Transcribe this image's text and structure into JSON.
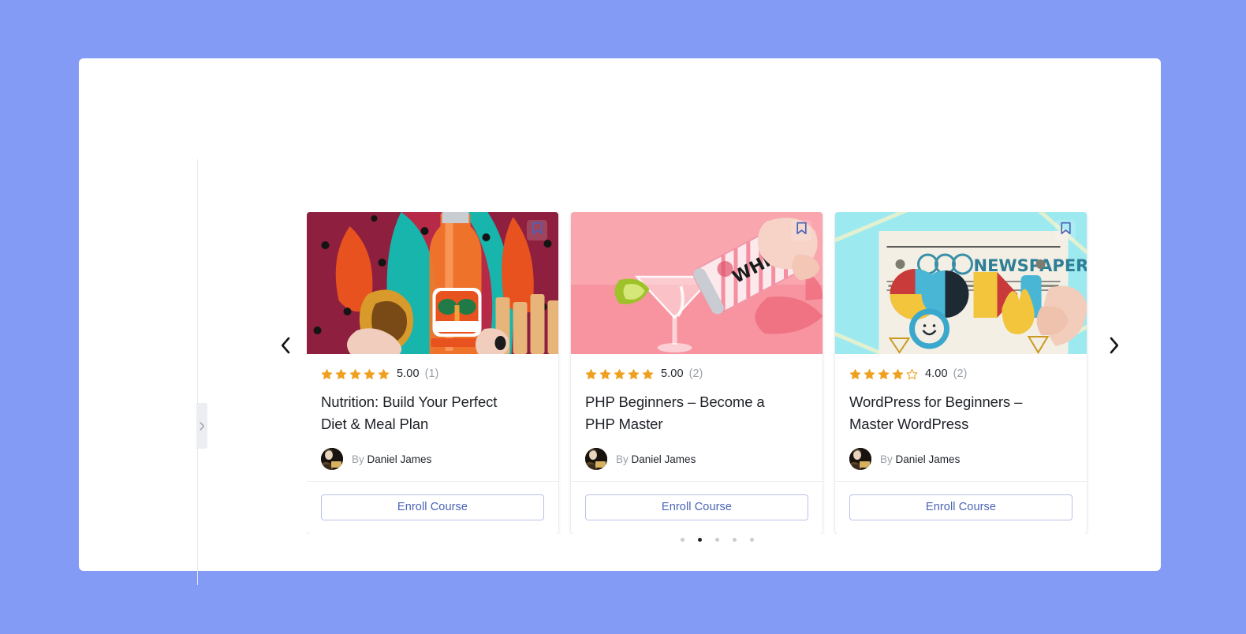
{
  "theme": {
    "page_background": "#849bf5",
    "sheet_background": "#ffffff",
    "star_color": "#efa020",
    "enroll_text_color": "#4a63b5",
    "enroll_border_color": "#b9c2e8",
    "bookmark_color": "#4a63b5",
    "active_dot_color": "#20242b",
    "inactive_dot_color": "#c9ccd2"
  },
  "carousel": {
    "prev_label": "‹",
    "next_label": "›",
    "prev_icon": "chevron-left-icon",
    "next_icon": "chevron-right-icon",
    "rail_tab_icon": "chevron-right-icon",
    "dots": [
      {
        "active": false
      },
      {
        "active": true
      },
      {
        "active": false
      },
      {
        "active": false
      },
      {
        "active": false
      }
    ],
    "cards": [
      {
        "rating_stars_filled": 5,
        "rating_value": "5.00",
        "rating_count": "(1)",
        "title": "Nutrition: Build Your Perfect Diet & Meal Plan",
        "author_prefix": "By",
        "author_name": "Daniel James",
        "enroll_label": "Enroll Course",
        "bookmark_icon": "bookmark-icon",
        "thumb_alt": "taco-and-jarritos-soda-photo"
      },
      {
        "rating_stars_filled": 5,
        "rating_value": "5.00",
        "rating_count": "(2)",
        "title": "PHP Beginners – Become a PHP Master",
        "author_prefix": "By",
        "author_name": "Daniel James",
        "enroll_label": "Enroll Course",
        "bookmark_icon": "bookmark-icon",
        "thumb_alt": "pink-cocktail-pour-photo"
      },
      {
        "rating_stars_filled": 4,
        "rating_value": "4.00",
        "rating_count": "(2)",
        "title": "WordPress for Beginners – Master WordPress",
        "author_prefix": "By",
        "author_name": "Daniel James",
        "enroll_label": "Enroll Course",
        "bookmark_icon": "bookmark-icon",
        "thumb_alt": "good-newspaper-photo"
      }
    ]
  }
}
